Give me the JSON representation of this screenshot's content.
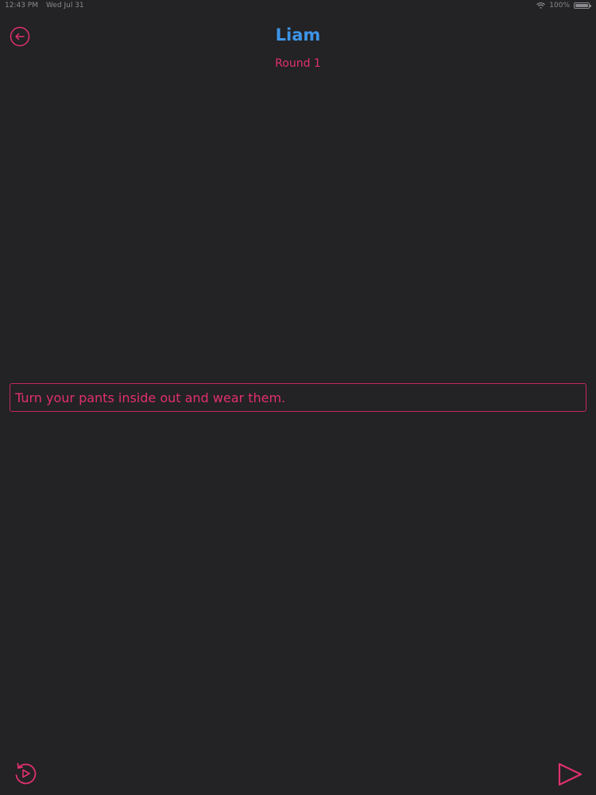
{
  "status_bar": {
    "time": "12:43 PM",
    "date": "Wed Jul 31",
    "battery": "100%"
  },
  "header": {
    "title": "Liam",
    "subtitle": "Round 1"
  },
  "dare": {
    "text": "Turn your pants inside out and wear them."
  },
  "icons": {
    "back": "arrow-left-circle-icon",
    "replay": "replay-icon",
    "play": "play-icon"
  },
  "colors": {
    "background": "#232224",
    "accent": "#e0306e",
    "title": "#3d95e8"
  }
}
